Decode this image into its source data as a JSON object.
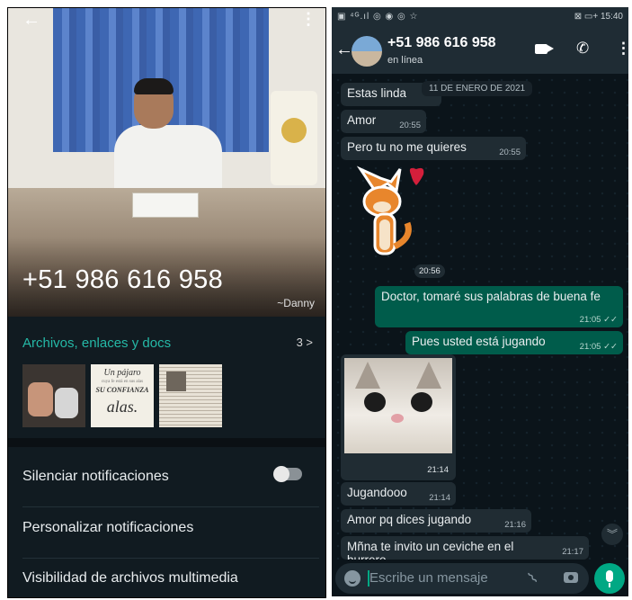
{
  "contact_info": {
    "phone": "+51 986 616 958",
    "nickname": "~Danny",
    "files_title": "Archivos, enlaces y docs",
    "files_count": "3 >",
    "thumb2": {
      "line1": "Un pájaro",
      "line2": "cuya fe está en sus alas",
      "line3": "SU CONFIANZA",
      "line4": "alas."
    },
    "settings": [
      "Silenciar notificaciones",
      "Personalizar notificaciones",
      "Visibilidad de archivos multimedia"
    ],
    "mute_toggle_on": false
  },
  "statusbar": {
    "left": "▣ ⁴ᴳ.ıl ◎ ◉ ◎ ☆",
    "right": "⊠ ▭+ 15:40"
  },
  "chat_header": {
    "name": "+51 986 616 958",
    "status": "en línea"
  },
  "date_chip": "11 DE ENERO DE 2021",
  "messages": [
    {
      "dir": "in",
      "text": "Estas linda",
      "time": ""
    },
    {
      "dir": "in",
      "text": "Amor",
      "time": "20:55"
    },
    {
      "dir": "in",
      "text": "Pero tu no me quieres",
      "time": "20:55"
    },
    {
      "dir": "in",
      "type": "sticker",
      "time": "20:56"
    },
    {
      "dir": "out",
      "text": "Doctor, tomaré sus palabras de buena fe",
      "time": "21:05 ✓✓"
    },
    {
      "dir": "out",
      "text": "Pues  usted está jugando",
      "time": "21:05 ✓✓"
    },
    {
      "dir": "in",
      "type": "image",
      "time": "21:14"
    },
    {
      "dir": "in",
      "text": "Jugandooo",
      "time": "21:14"
    },
    {
      "dir": "in",
      "text": "Amor pq dices jugando",
      "time": "21:16"
    },
    {
      "dir": "in",
      "text": "Mñna te invito un ceviche en el burrero",
      "time": "21:17"
    }
  ],
  "composer": {
    "placeholder": "Escribe un mensaje"
  },
  "colors": {
    "accent": "#00a884",
    "header": "#1f2c34",
    "bubble_in": "#202c33",
    "bubble_out": "#005c4b",
    "link_teal": "#25b9a7"
  }
}
